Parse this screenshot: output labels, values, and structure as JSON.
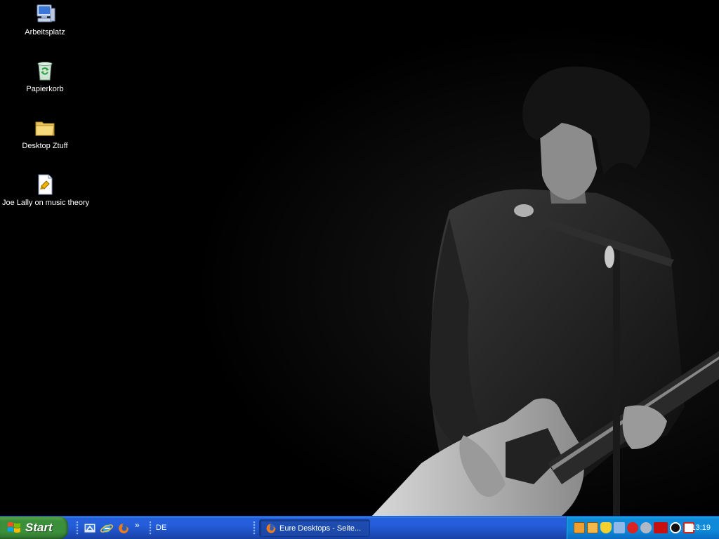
{
  "desktop": {
    "icons": [
      {
        "label": "Arbeitsplatz",
        "icon": "my-computer-icon"
      },
      {
        "label": "Papierkorb",
        "icon": "recycle-bin-icon"
      },
      {
        "label": "Desktop Ztuff",
        "icon": "folder-icon"
      },
      {
        "label": "Joe Lally on music theory",
        "icon": "document-icon"
      }
    ],
    "wallpaper": "guitarist-at-microphone-photo"
  },
  "taskbar": {
    "start_label": "Start",
    "quick_launch": [
      {
        "icon": "show-desktop-icon"
      },
      {
        "icon": "internet-explorer-icon"
      },
      {
        "icon": "firefox-icon"
      }
    ],
    "quick_launch_more": "»",
    "language": "DE",
    "windows": [
      {
        "title": "Eure Desktops - Seite...",
        "icon": "firefox-icon"
      }
    ],
    "tray": {
      "icons": [
        "tray-app-1-icon",
        "tray-app-2-icon",
        "security-shield-icon",
        "network-icon",
        "antivirus-icon",
        "sound-icon",
        "ati-icon",
        "ati-catalyst-icon",
        "updater-icon"
      ],
      "clock": "13:19"
    }
  },
  "colors": {
    "taskbar_blue": "#245edb",
    "start_green": "#3c8f3a",
    "tray_blue": "#0f8ad9"
  }
}
